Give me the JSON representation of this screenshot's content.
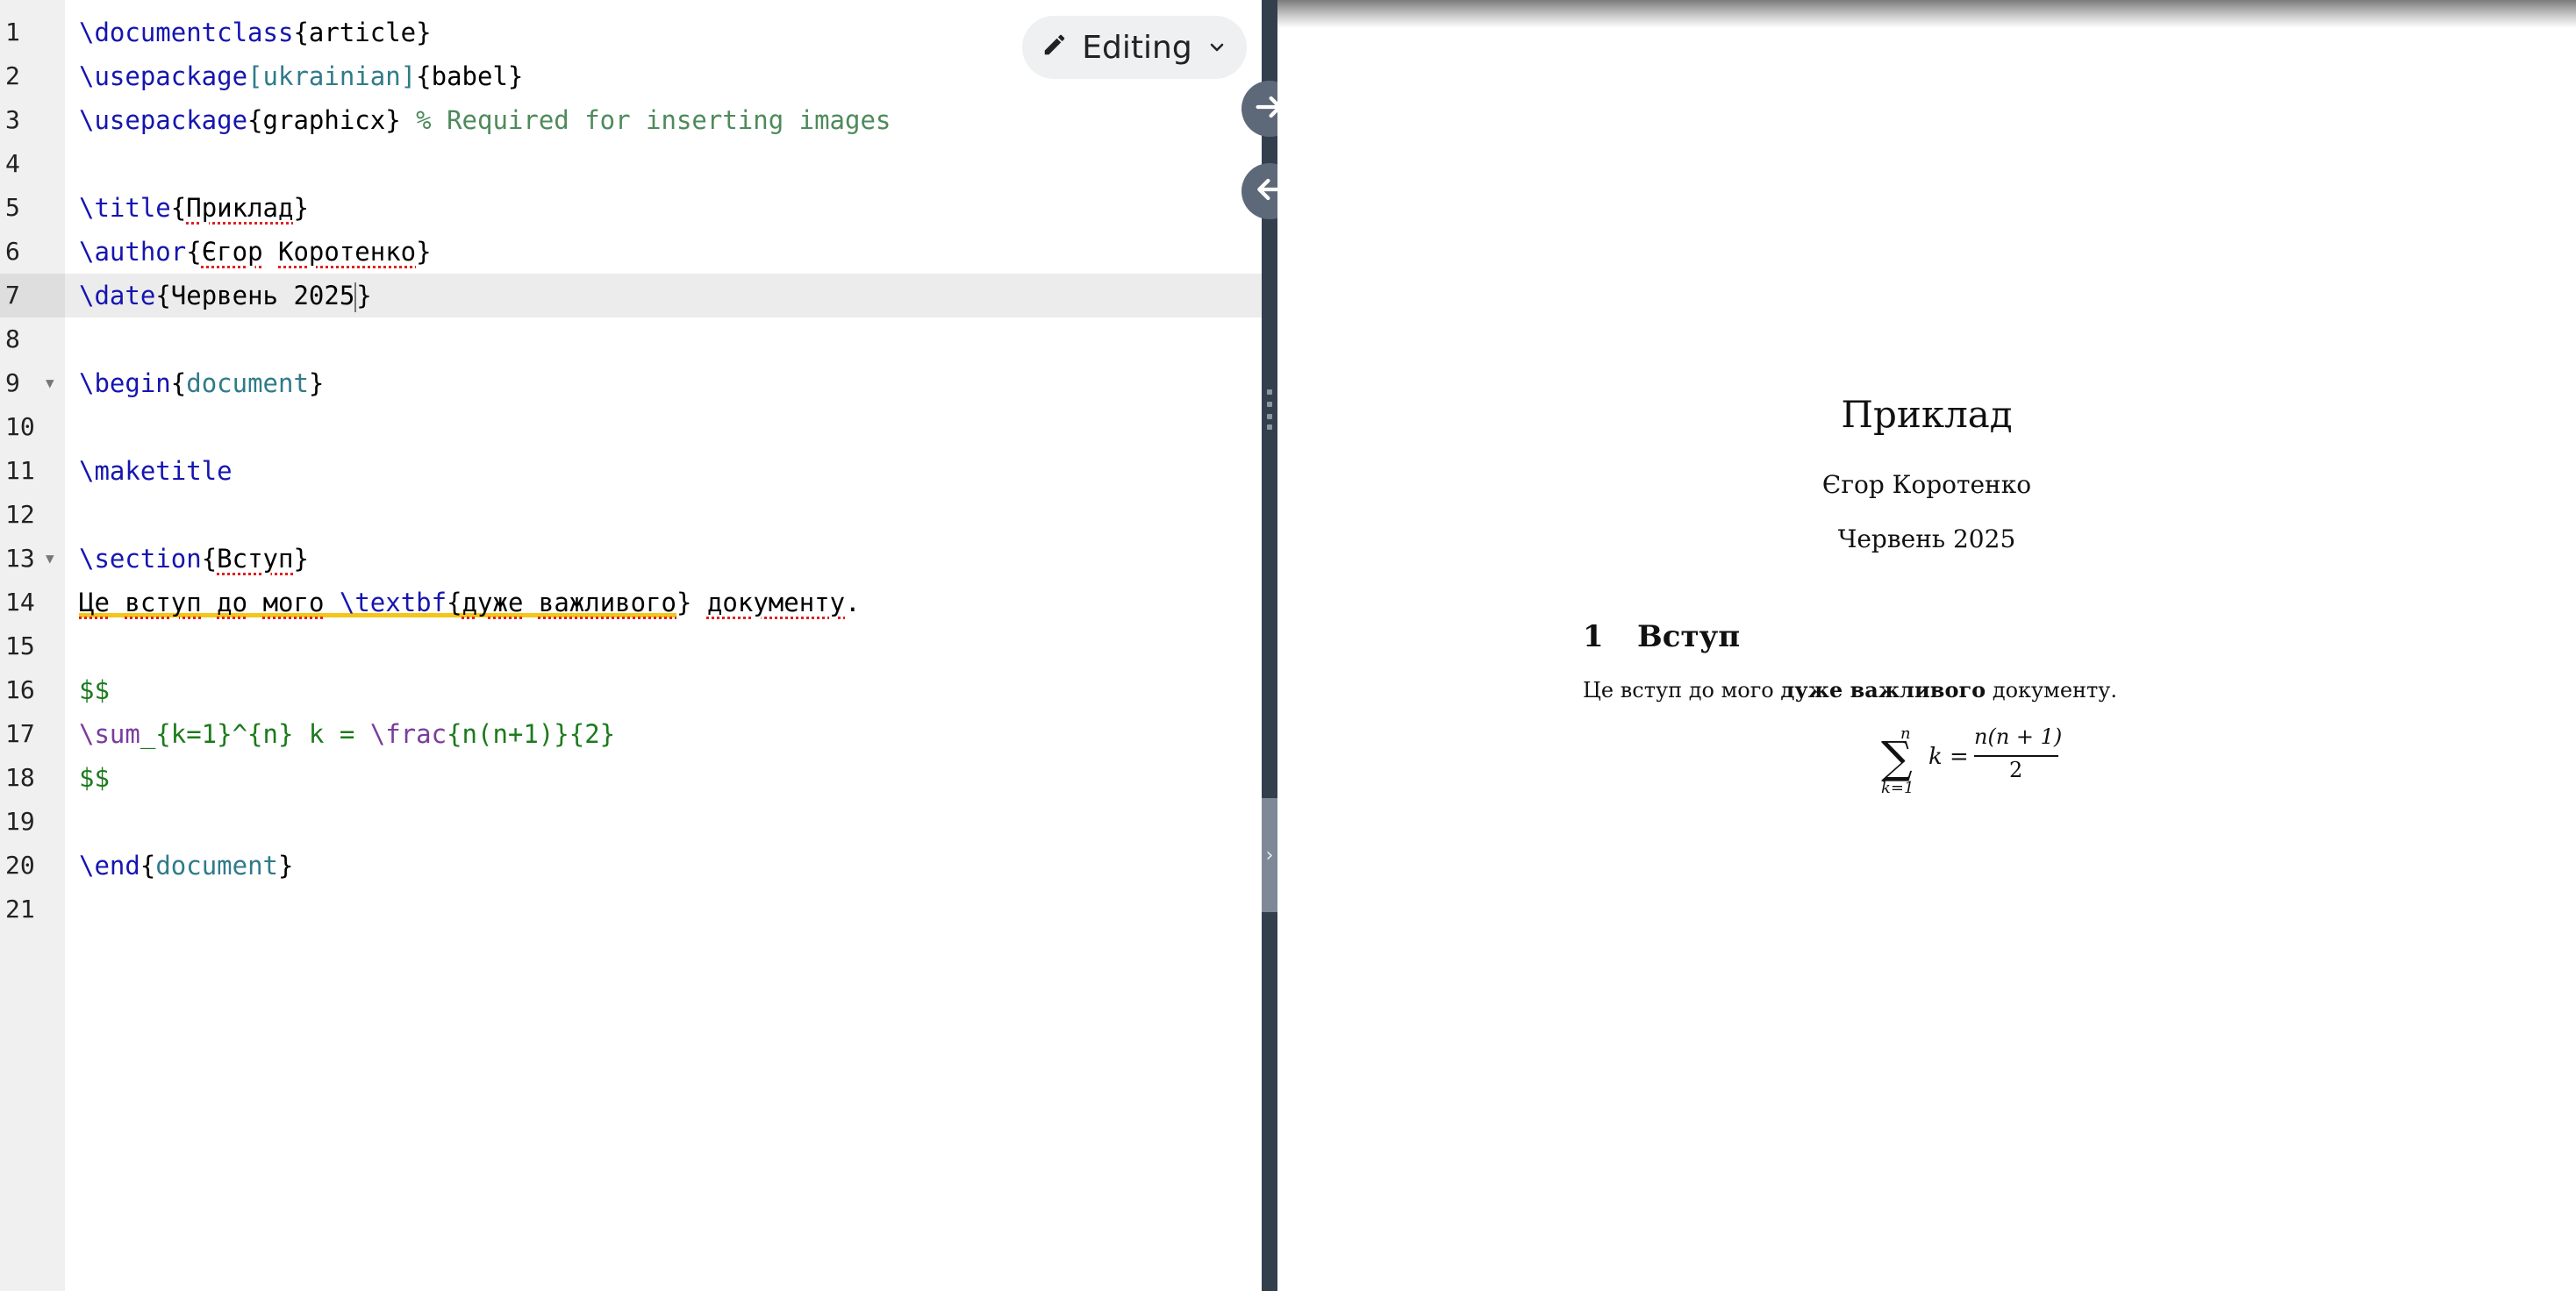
{
  "editor": {
    "mode_button_label": "Editing",
    "active_line": 7,
    "lines": [
      {
        "n": "1"
      },
      {
        "n": "2"
      },
      {
        "n": "3"
      },
      {
        "n": "4"
      },
      {
        "n": "5"
      },
      {
        "n": "6"
      },
      {
        "n": "7"
      },
      {
        "n": "8"
      },
      {
        "n": "9"
      },
      {
        "n": "10"
      },
      {
        "n": "11"
      },
      {
        "n": "12"
      },
      {
        "n": "13"
      },
      {
        "n": "14"
      },
      {
        "n": "15"
      },
      {
        "n": "16"
      },
      {
        "n": "17"
      },
      {
        "n": "18"
      },
      {
        "n": "19"
      },
      {
        "n": "20"
      },
      {
        "n": "21"
      }
    ],
    "code": {
      "l1": {
        "cmd": "\\documentclass",
        "b1": "{",
        "arg": "article",
        "b2": "}"
      },
      "l2": {
        "cmd": "\\usepackage",
        "o1": "[",
        "opt": "ukrainian",
        "o2": "]",
        "b1": "{",
        "arg": "babel",
        "b2": "}"
      },
      "l3": {
        "cmd": "\\usepackage",
        "b1": "{",
        "arg": "graphicx",
        "b2": "}",
        "comment": " % Required for inserting images"
      },
      "l5": {
        "cmd": "\\title",
        "b1": "{",
        "arg": "Приклад",
        "b2": "}"
      },
      "l6": {
        "cmd": "\\author",
        "b1": "{",
        "arg1": "Єгор",
        "sp": " ",
        "arg2": "Коротенко",
        "b2": "}"
      },
      "l7": {
        "cmd": "\\date",
        "b1": "{",
        "arg": "Червень 2025",
        "b2": "}"
      },
      "l9": {
        "cmd": "\\begin",
        "b1": "{",
        "arg": "document",
        "b2": "}"
      },
      "l11": {
        "cmd": "\\maketitle"
      },
      "l13": {
        "cmd": "\\section",
        "b1": "{",
        "arg": "Вступ",
        "b2": "}"
      },
      "l14": {
        "t1": "Це",
        "s1": " ",
        "t2": "вступ",
        "s2": " ",
        "t3": "до",
        "s3": " ",
        "t4": "мого",
        "s4": " ",
        "cmd": "\\textbf",
        "b1": "{",
        "t5": "дуже",
        "s5": " ",
        "t6": "важливого",
        "b2": "}",
        "s6": " ",
        "t7": "документу",
        "t8": "."
      },
      "l16": {
        "math": "$$"
      },
      "l17": {
        "p1": "\\sum",
        "p2": "_{k=1}^{n} k = ",
        "p3": "\\frac",
        "p4": "{n(n+1)}{2}"
      },
      "l18": {
        "math": "$$"
      },
      "l20": {
        "cmd": "\\end",
        "b1": "{",
        "arg": "document",
        "b2": "}"
      }
    }
  },
  "preview": {
    "title": "Приклад",
    "author": "Єгор Коротенко",
    "date": "Червень 2025",
    "section_number": "1",
    "section_title": "Вступ",
    "body_prefix": "Це вступ до мого ",
    "body_bold": "дуже важливого",
    "body_suffix": " документу.",
    "equation": {
      "sum": "∑",
      "upper": "n",
      "lower": "k=1",
      "var": "k =",
      "numerator": "n(n + 1)",
      "denominator": "2"
    }
  }
}
